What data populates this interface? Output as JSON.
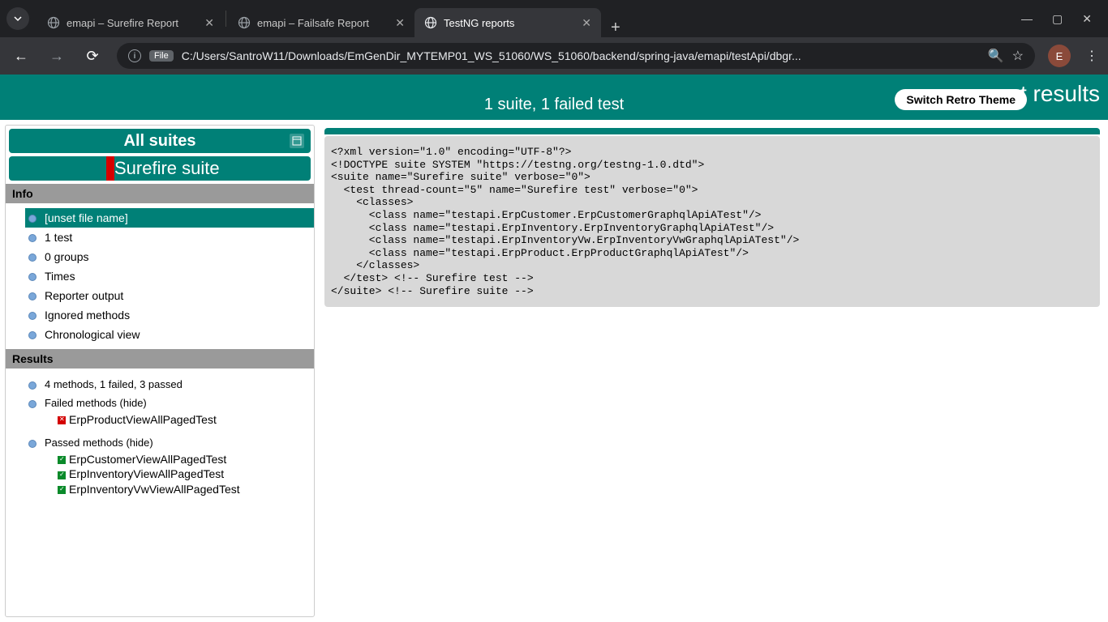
{
  "chrome": {
    "tabs": [
      {
        "title": "emapi – Surefire Report",
        "active": false
      },
      {
        "title": "emapi – Failsafe Report",
        "active": false
      },
      {
        "title": "TestNG reports",
        "active": true
      }
    ],
    "url": "C:/Users/SantroW11/Downloads/EmGenDir_MYTEMP01_WS_51060/WS_51060/backend/spring-java/emapi/testApi/dbgr...",
    "file_chip": "File",
    "avatar_letter": "E"
  },
  "banner": {
    "subtitle": "1 suite, 1 failed test",
    "title_clip": "st results",
    "retro_btn": "Switch Retro Theme"
  },
  "left": {
    "all_suites": "All suites",
    "suite_name": "Surefire suite",
    "info_hdr": "Info",
    "info_items": [
      "[unset file name]",
      "1 test",
      "0 groups",
      "Times",
      "Reporter output",
      "Ignored methods",
      "Chronological view"
    ],
    "results_hdr": "Results",
    "results_summary": "4 methods, 1 failed, 3 passed",
    "failed_label": "Failed methods",
    "hide_label": "(hide)",
    "failed_methods": [
      "ErpProductViewAllPagedTest"
    ],
    "passed_label": "Passed methods",
    "passed_methods": [
      "ErpCustomerViewAllPagedTest",
      "ErpInventoryViewAllPagedTest",
      "ErpInventoryVwViewAllPagedTest"
    ]
  },
  "xml": "<?xml version=\"1.0\" encoding=\"UTF-8\"?>\n<!DOCTYPE suite SYSTEM \"https://testng.org/testng-1.0.dtd\">\n<suite name=\"Surefire suite\" verbose=\"0\">\n  <test thread-count=\"5\" name=\"Surefire test\" verbose=\"0\">\n    <classes>\n      <class name=\"testapi.ErpCustomer.ErpCustomerGraphqlApiATest\"/>\n      <class name=\"testapi.ErpInventory.ErpInventoryGraphqlApiATest\"/>\n      <class name=\"testapi.ErpInventoryVw.ErpInventoryVwGraphqlApiATest\"/>\n      <class name=\"testapi.ErpProduct.ErpProductGraphqlApiATest\"/>\n    </classes>\n  </test> <!-- Surefire test -->\n</suite> <!-- Surefire suite -->"
}
